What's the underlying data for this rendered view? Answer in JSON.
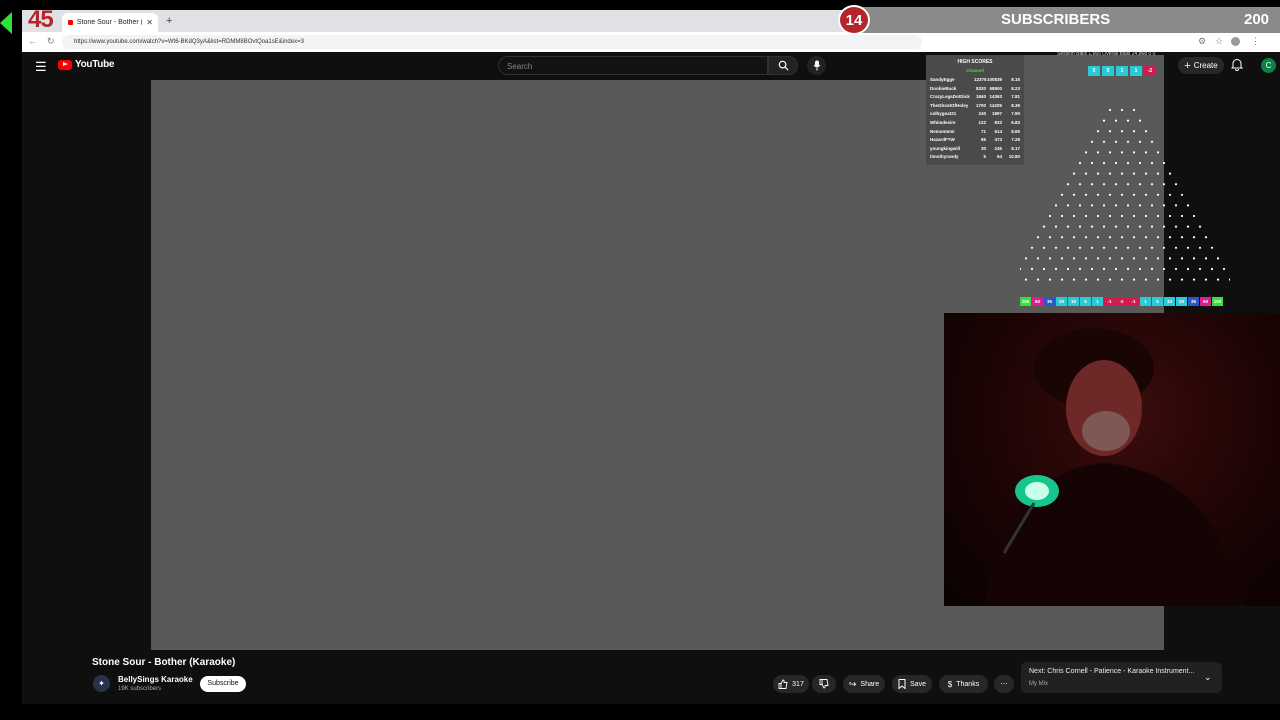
{
  "browser": {
    "tab_title": "Stone Sour - Bother (Karaoke)",
    "url": "https://www.youtube.com/watch?v=Wt6-BKdQ3yA&list=RDMM8BOvtQoa1sE&index=3"
  },
  "youtube": {
    "logo_text": "YouTube",
    "search_placeholder": "Search",
    "create_label": "Create",
    "avatar_letter": "C",
    "video_title": "Stone Sour - Bother (Karaoke)",
    "channel_name": "BellySings Karaoke",
    "channel_subs": "19K subscribers",
    "subscribe_label": "Subscribe",
    "like_count": "317",
    "share_label": "Share",
    "save_label": "Save",
    "thanks_label": "Thanks",
    "next_title": "Next: Chris Cornell - Patience - Karaoke Instrument...",
    "next_sub": "My Mix"
  },
  "overlay": {
    "timer": "45",
    "subscriber_count": "14",
    "subscriber_label": "SUBSCRIBERS",
    "subscriber_goal": "200",
    "session_stats": "Session Balls  1,665    Overall Balls  24,868    0    0",
    "high_scores": {
      "title": "HIGH SCORES",
      "subtitle": "Channel",
      "rows": [
        {
          "name": "SandyEgge",
          "a": "12375",
          "b": "100839",
          "c": "8.15"
        },
        {
          "name": "DoobieBuck",
          "a": "8320",
          "b": "68500",
          "c": "8.23"
        },
        {
          "name": "CrazyLegsDotDick",
          "a": "1840",
          "b": "14363",
          "c": "7.81"
        },
        {
          "name": "TheGhostOfHoley",
          "a": "1700",
          "b": "14205",
          "c": "8.36"
        },
        {
          "name": "colbygoat21",
          "a": "240",
          "b": "1897",
          "c": "7.90"
        },
        {
          "name": "Whimdesire",
          "a": "122",
          "b": "833",
          "c": "6.83"
        },
        {
          "name": "Nemontemi",
          "a": "71",
          "b": "614",
          "c": "8.65"
        },
        {
          "name": "HazardFTW",
          "a": "65",
          "b": "473",
          "c": "7.28"
        },
        {
          "name": "youngkingwill",
          "a": "30",
          "b": "245",
          "c": "8.17"
        },
        {
          "name": "timothyrandy",
          "a": "5",
          "b": "54",
          "c": "10.80"
        }
      ]
    },
    "top_slots": [
      {
        "label": "5",
        "color": "#29c9d6"
      },
      {
        "label": "5",
        "color": "#29c9d6"
      },
      {
        "label": "1",
        "color": "#29c9d6"
      },
      {
        "label": "1",
        "color": "#29c9d6"
      },
      {
        "label": "-2",
        "color": "#d11a4f"
      }
    ],
    "bottom_slots": [
      {
        "label": "100",
        "color": "#2ee534"
      },
      {
        "label": "50",
        "color": "#e01a8f"
      },
      {
        "label": "35",
        "color": "#2a58c9"
      },
      {
        "label": "20",
        "color": "#29c9d6"
      },
      {
        "label": "10",
        "color": "#29c9d6"
      },
      {
        "label": "5",
        "color": "#29c9d6"
      },
      {
        "label": "1",
        "color": "#29c9d6"
      },
      {
        "label": "-1",
        "color": "#d11a4f"
      },
      {
        "label": "-2",
        "color": "#d11a4f"
      },
      {
        "label": "-1",
        "color": "#d11a4f"
      },
      {
        "label": "1",
        "color": "#29c9d6"
      },
      {
        "label": "5",
        "color": "#29c9d6"
      },
      {
        "label": "10",
        "color": "#29c9d6"
      },
      {
        "label": "20",
        "color": "#29c9d6"
      },
      {
        "label": "35",
        "color": "#2a58c9"
      },
      {
        "label": "50",
        "color": "#e01a8f"
      },
      {
        "label": "100",
        "color": "#2ee534"
      }
    ]
  }
}
